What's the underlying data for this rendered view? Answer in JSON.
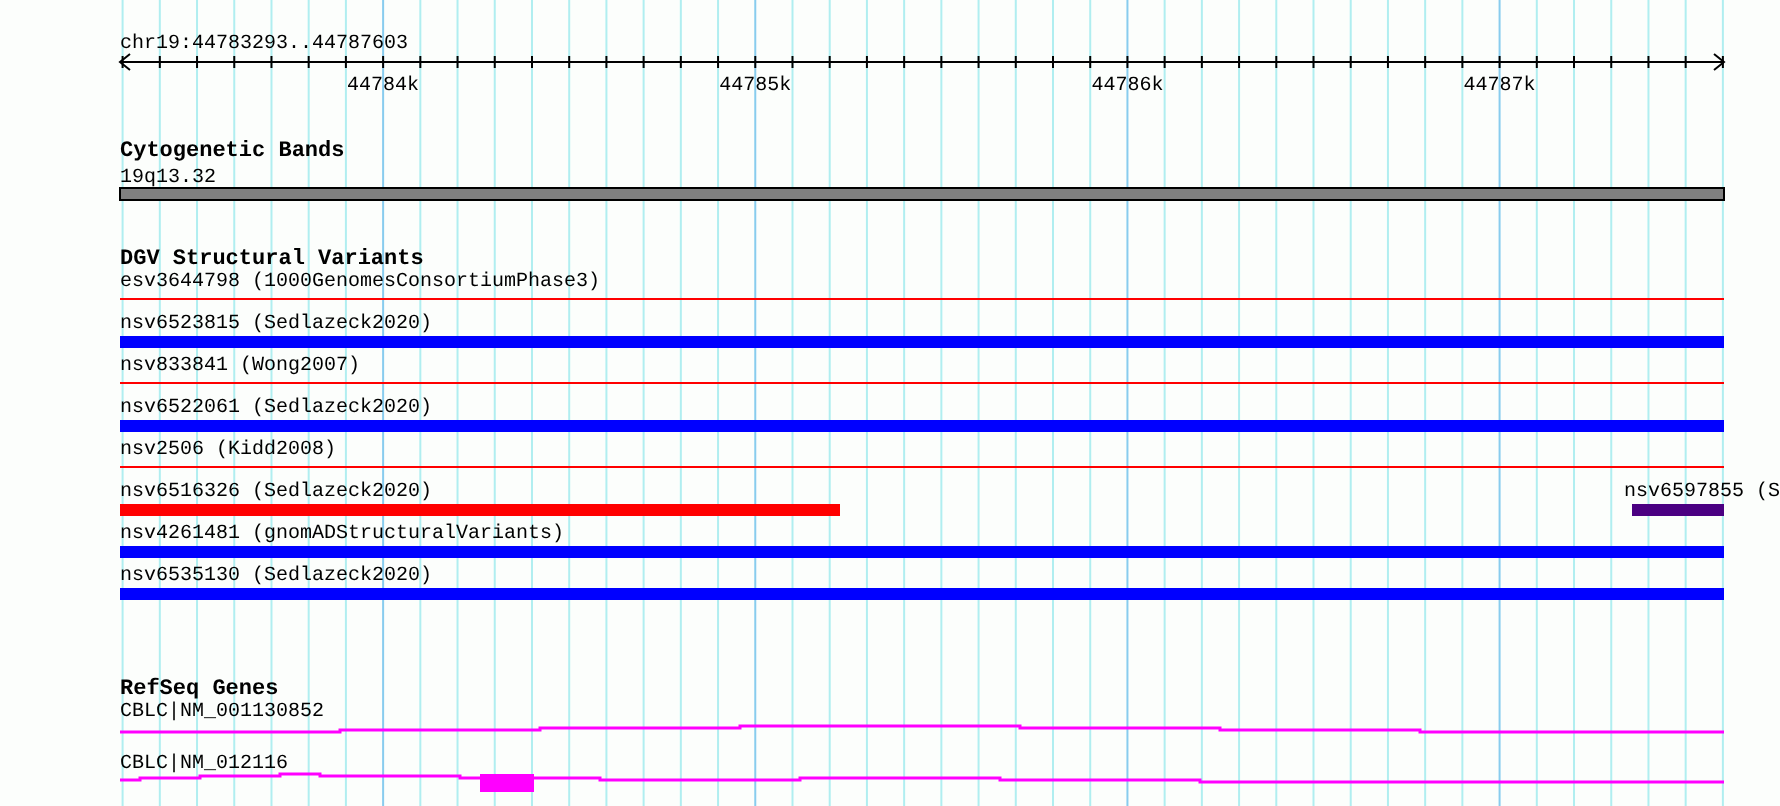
{
  "ruler": {
    "range_label": "chr19:44783293..44787603",
    "ticks": [
      "44784k",
      "44785k",
      "44786k",
      "44787k"
    ]
  },
  "tracks": [
    {
      "title": "Cytogenetic Bands",
      "features": [
        {
          "label": "19q13.32",
          "kind": "band",
          "color": "#808080"
        }
      ]
    },
    {
      "title": "DGV Structural Variants",
      "features": [
        {
          "label": "esv3644798 (1000GenomesConsortiumPhase3)",
          "kind": "line",
          "color": "#ff0000"
        },
        {
          "label": "nsv6523815 (Sedlazeck2020)",
          "kind": "bar",
          "color": "#0000ff"
        },
        {
          "label": "nsv833841 (Wong2007)",
          "kind": "line",
          "color": "#ff0000"
        },
        {
          "label": "nsv6522061 (Sedlazeck2020)",
          "kind": "bar",
          "color": "#0000ff"
        },
        {
          "label": "nsv2506 (Kidd2008)",
          "kind": "line",
          "color": "#ff0000"
        },
        {
          "label": "nsv6516326 (Sedlazeck2020)",
          "kind": "bar",
          "color": "#ff0000"
        },
        {
          "label": "nsv6597855 (S",
          "kind": "bar",
          "color": "#4b0082"
        },
        {
          "label": "nsv4261481 (gnomADStructuralVariants)",
          "kind": "bar",
          "color": "#0000ff"
        },
        {
          "label": "nsv6535130 (Sedlazeck2020)",
          "kind": "bar",
          "color": "#0000ff"
        }
      ]
    },
    {
      "title": "RefSeq Genes",
      "features": [
        {
          "label": "CBLC|NM_001130852",
          "kind": "transcript",
          "color": "#ff00ff"
        },
        {
          "label": "CBLC|NM_012116",
          "kind": "transcript",
          "color": "#ff00ff"
        }
      ]
    }
  ]
}
